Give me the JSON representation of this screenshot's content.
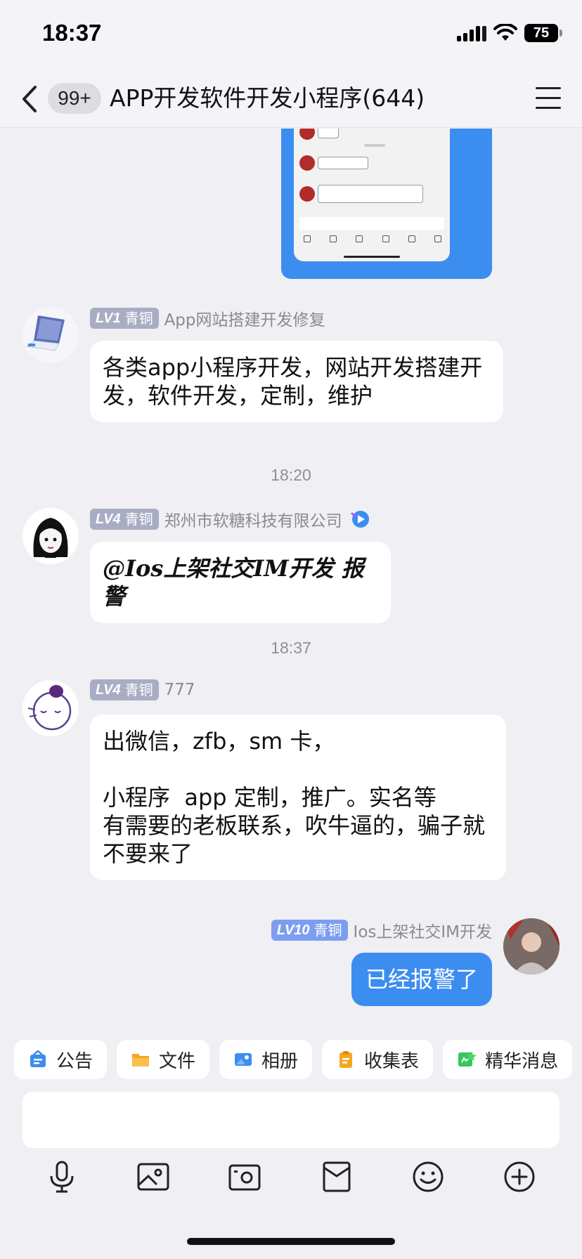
{
  "status_bar": {
    "time": "18:37",
    "battery": "75"
  },
  "nav": {
    "unread_badge": "99+",
    "title": "APP开发软件开发小程序(644)"
  },
  "messages": [
    {
      "level": "LV1",
      "rank": "青铜",
      "sender": "App网站搭建开发修复",
      "text": "各类app小程序开发，网站开发搭建开发，软件开发，定制，维护"
    },
    {
      "level": "LV4",
      "rank": "青铜",
      "sender": "郑州市软糖科技有限公司",
      "text": "@Ios上架社交IM开发 报警"
    },
    {
      "level": "LV4",
      "rank": "青铜",
      "sender": "777",
      "text": "出微信，zfb，sm 卡，\n\n小程序  app 定制，推广。实名等\n有需要的老板联系，吹牛逼的，骗子就不要来了"
    },
    {
      "level": "LV10",
      "rank": "青铜",
      "sender": "Ios上架社交IM开发",
      "text": "已经报警了"
    }
  ],
  "timestamps": [
    "18:20",
    "18:37"
  ],
  "quick_actions": [
    "公告",
    "文件",
    "相册",
    "收集表",
    "精华消息"
  ],
  "input": {
    "placeholder": ""
  },
  "colors": {
    "accent": "#3c8df0",
    "badge": "#a9adc4",
    "badge_self": "#7d9ef0"
  },
  "toolbar_icons": [
    "microphone-icon",
    "image-icon",
    "camera-icon",
    "red-packet-icon",
    "emoji-icon",
    "plus-icon"
  ]
}
